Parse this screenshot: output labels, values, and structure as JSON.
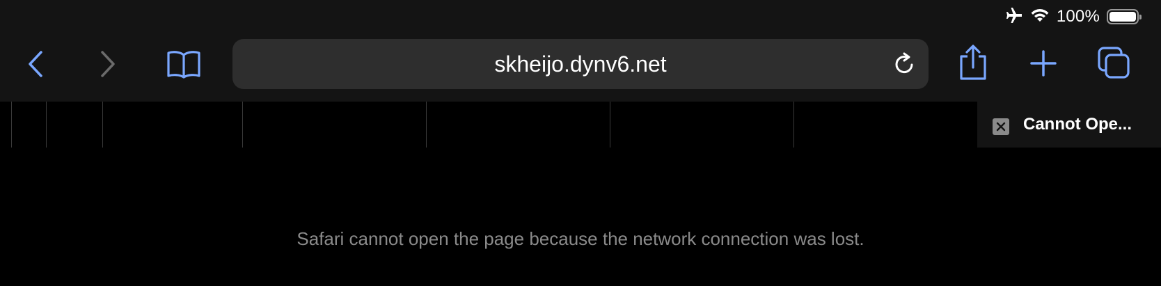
{
  "status_bar": {
    "airplane_icon": "airplane-icon",
    "wifi_icon": "wifi-icon",
    "battery_percent": "100%",
    "battery_level": 1.0
  },
  "toolbar": {
    "back_icon": "chevron-left-icon",
    "forward_icon": "chevron-right-icon",
    "bookmarks_icon": "book-icon",
    "address": "skheijo.dynv6.net",
    "reload_icon": "reload-icon",
    "share_icon": "share-icon",
    "new_tab_icon": "plus-icon",
    "tabs_icon": "tabs-icon"
  },
  "tabs": {
    "active_title": "Cannot Ope..."
  },
  "content": {
    "error_message": "Safari cannot open the page because the network connection was lost."
  },
  "colors": {
    "accent": "#7aa7ff",
    "disabled": "#6b6b6b",
    "toolbar_bg": "#141414",
    "address_bg": "#2e2e2e",
    "error_text": "#8a8a8a"
  }
}
